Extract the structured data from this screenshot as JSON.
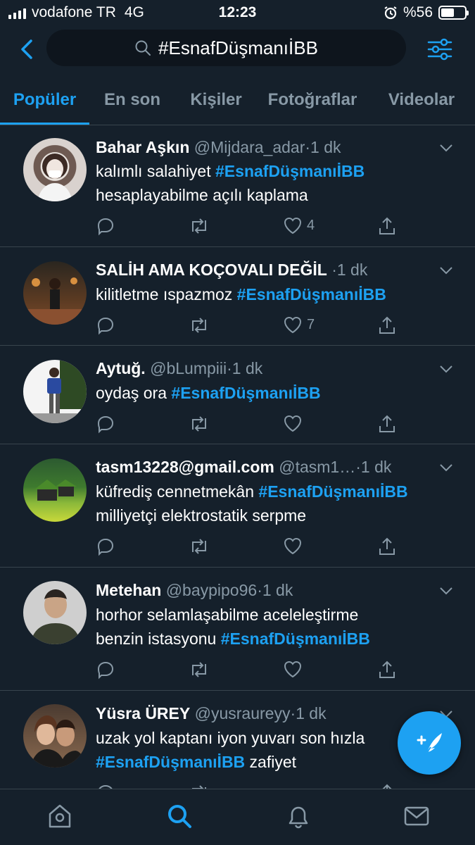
{
  "status_bar": {
    "carrier": "vodafone TR",
    "network": "4G",
    "time": "12:23",
    "battery": "%56",
    "battery_level": 0.56
  },
  "search": {
    "query": "#EsnafDüşmanıİBB"
  },
  "tabs": [
    {
      "label": "Popüler"
    },
    {
      "label": "En son"
    },
    {
      "label": "Kişiler"
    },
    {
      "label": "Fotoğraflar"
    },
    {
      "label": "Videolar"
    }
  ],
  "tweets": [
    {
      "name": "Bahar Aşkın",
      "handle": "@Mijdara_adar",
      "time": "1 dk",
      "text_before": "kalımlı salahiyet ",
      "hashtag": "#EsnafDüşmanıİBB",
      "text_line2": "hesaplayabilme açılı kaplama",
      "likes": "4"
    },
    {
      "name": "SALİH AMA KOÇOVALI DEĞİL",
      "handle": "",
      "time": "1 dk",
      "text_before": "kilitletme ıspazmoz ",
      "hashtag": "#EsnafDüşmanıİBB",
      "likes": "7"
    },
    {
      "name": "Aytuğ.",
      "handle": "@bLumpiii",
      "time": "1 dk",
      "text_before": "oydaş ora ",
      "hashtag": "#EsnafDüşmanıİBB"
    },
    {
      "name": "tasm13228@gmail.com",
      "handle": "@tasm1…",
      "time": "1 dk",
      "text_before": "küfrediş cennetmekân ",
      "hashtag": "#EsnafDüşmanıİBB",
      "text_line2": "milliyetçi elektrostatik serpme"
    },
    {
      "name": "Metehan",
      "handle": "@baypipo96",
      "time": "1 dk",
      "text_line1": "horhor selamlaşabilme aceleleştirme",
      "text_before": "benzin istasyonu ",
      "hashtag": "#EsnafDüşmanıİBB"
    },
    {
      "name": "Yüsra ÜREY",
      "handle": "@yusraureyy",
      "time": "1 dk",
      "text_line1": "uzak yol kaptanı iyon yuvarı son hızla",
      "hashtag": "#EsnafDüşmanıİBB",
      "text_after": " zafiyet"
    }
  ],
  "colors": {
    "background": "#15202b",
    "accent": "#1da1f2",
    "muted": "#8899a6",
    "divider": "#38444d"
  }
}
